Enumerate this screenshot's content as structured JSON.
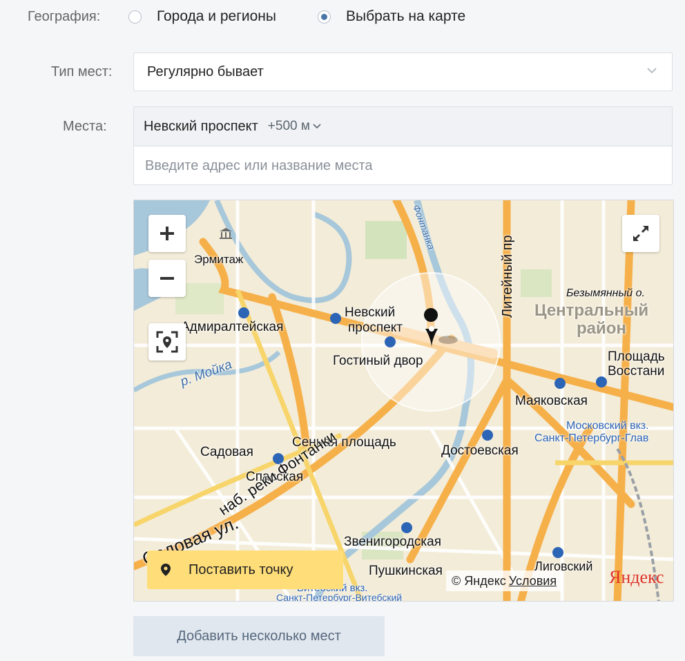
{
  "geography": {
    "label": "География:",
    "options": [
      {
        "label": "Города и регионы",
        "checked": false
      },
      {
        "label": "Выбрать на карте",
        "checked": true
      }
    ]
  },
  "place_type": {
    "label": "Тип мест:",
    "selected": "Регулярно бывает"
  },
  "places": {
    "label": "Места:",
    "tag_name": "Невский проспект",
    "tag_radius": "+500 м",
    "input_placeholder": "Введите адрес или название места"
  },
  "map": {
    "labels": {
      "hermitage": "Эрмитаж",
      "admiralteyskaya": "Адмиралтейская",
      "moika": "р. Мойка",
      "nevsky_station_1": "Невский",
      "nevsky_station_2": "проспект",
      "gostiny": "Гостиный двор",
      "liteyny": "Литейный пр",
      "bezymyanny": "Безымянный о.",
      "central_1": "Центральный",
      "central_2": "район",
      "ploshchad_1": "Площадь",
      "ploshchad_2": "Восстани",
      "mayakovskaya": "Маяковская",
      "moskovsky_1": "Московский вкз.",
      "moskovsky_2": "Санкт-Петербург-Глав",
      "sadovaya": "Садовая",
      "sennaya": "Сенная площадь",
      "dostoevskaya": "Достоевская",
      "spasskaya": "Спасская",
      "sadovaya_ul": "Садовая ул.",
      "fontanka": "наб. реки Фонтанки",
      "zvenigorodskaya": "Звенигородская",
      "pushkinskaya": "Пушкинская",
      "ligovsky": "Лиговский",
      "vitebsky_1": "Витебский вкз.",
      "vitebsky_2": "Санкт-Петербург-Витебский",
      "fontanka_top": "Фонтанка"
    },
    "place_point_label": "Поставить точку",
    "copyright": "© Яндекс",
    "terms": "Условия",
    "logo": "Яндекс"
  },
  "add_button": "Добавить несколько мест",
  "colors": {
    "accent": "#4a76a8",
    "button_yellow": "#ffdd78",
    "metro": "#2c64b6"
  }
}
